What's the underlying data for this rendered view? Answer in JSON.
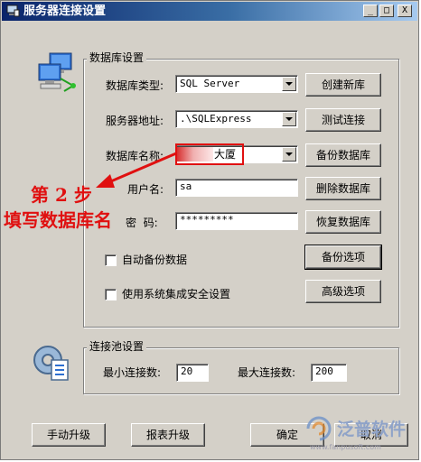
{
  "window": {
    "title": "服务器连接设置",
    "controls": [
      "_",
      "□",
      "X"
    ]
  },
  "db_group": {
    "title": "数据库设置",
    "type_label": "数据库类型:",
    "type_value": "SQL Server",
    "server_label": "服务器地址:",
    "server_value": ".\\SQLExpress",
    "name_label": "数据库名称:",
    "name_value": "大厦",
    "user_label": "用户名:",
    "user_value": "sa",
    "pwd_label": "密  码:",
    "pwd_value": "*********",
    "auto_backup_label": "自动备份数据",
    "auto_backup_checked": false,
    "integrated_label": "使用系统集成安全设置",
    "integrated_checked": false,
    "buttons": {
      "create": "创建新库",
      "test": "测试连接",
      "backup": "备份数据库",
      "delete": "删除数据库",
      "restore": "恢复数据库",
      "backup_options": "备份选项",
      "advanced": "高级选项"
    }
  },
  "pool_group": {
    "title": "连接池设置",
    "min_label": "最小连接数:",
    "min_value": "20",
    "max_label": "最大连接数:",
    "max_value": "200"
  },
  "footer": {
    "manual_upgrade": "手动升级",
    "report_upgrade": "报表升级",
    "ok": "确定",
    "cancel": "取消"
  },
  "annotation": {
    "step": "第 2 步",
    "instruction": "填写数据库名"
  },
  "watermark": {
    "brand": "泛普软件",
    "url": "www.fanpusoft.com"
  },
  "colors": {
    "annotation_red": "#e01010",
    "titlebar_dark": "#0a246a",
    "dialog_face": "#d4d0c8"
  }
}
